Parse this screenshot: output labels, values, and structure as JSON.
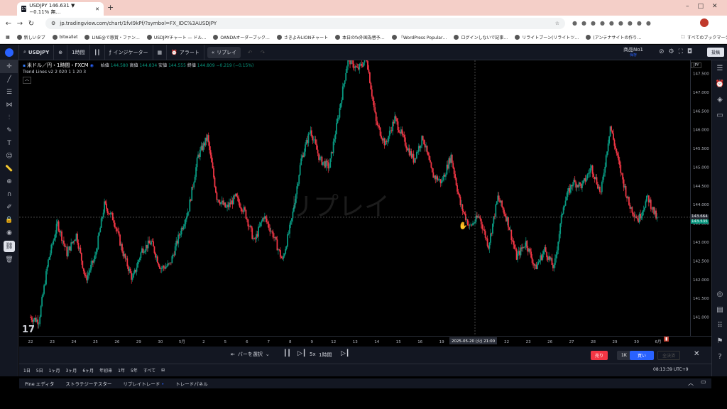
{
  "browser": {
    "tab_title": "USDJPY 146.631 ▼ −0.11% 無…",
    "url": "jp.tradingview.com/chart/1fvI9kPf/?symbol=FX_IDC%3AUSDJPY",
    "bookmarks": [
      "新しいタブ",
      "bitwallet",
      "LINE@で懸賞・ファン…",
      "USDJPYチャート — ドル…",
      "OANDAオーダーブック…",
      "さきよみLIONチャート",
      "本日のfx外国為替予…",
      "「WordPress Popular…",
      "ログインしないで記事…",
      "リライトブーン(リライトツ…",
      "(アンテナサイトの作り…"
    ],
    "bookmarks_all": "すべてのブックマーク"
  },
  "toolbar": {
    "symbol": "USDJPY",
    "interval": "1時間",
    "indicators": "インジケーター",
    "alert": "アラート",
    "replay": "リプレイ",
    "product": "商品No1",
    "product_sub": "保存",
    "publish": "投稿"
  },
  "legend": {
    "title": "米ドル／円・1時間・FXCM",
    "o_label": "始値",
    "o": "144.580",
    "h_label": "高値",
    "h": "144.834",
    "l_label": "安値",
    "l": "144.555",
    "c_label": "終値",
    "c": "144.809",
    "chg": "−0.219 (−0.15%)",
    "indicator": "Trend Lines v2  2 020 1 1 20 3"
  },
  "watermark": "リプレイ",
  "price_axis": {
    "currency": "JPY",
    "current": "143.664",
    "current2": "143.535"
  },
  "crosshair_time": "2025-05-20 (火)  21:00",
  "replay": {
    "select": "バーを選択",
    "speed": "5x",
    "interval": "1時間",
    "sell": "売り",
    "qty": "1K",
    "buy": "買い",
    "exit": "全決済"
  },
  "ranges": [
    "1日",
    "5日",
    "1ヶ月",
    "3ヶ月",
    "6ヶ月",
    "年初来",
    "1年",
    "5年",
    "すべて"
  ],
  "clock": "08:13:39 UTC+9",
  "panels": [
    "Pine エディタ",
    "ストラテジーテスター",
    "リプレイトレード",
    "トレードパネル"
  ],
  "chart_data": {
    "type": "candlestick",
    "symbol": "USDJPY",
    "interval": "1h",
    "x_ticks": [
      "22",
      "23",
      "24",
      "25",
      "26",
      "29",
      "30",
      "5月",
      "2",
      "5",
      "6",
      "7",
      "8",
      "9",
      "12",
      "13",
      "14",
      "15",
      "16",
      "19",
      "20",
      "21",
      "22",
      "23",
      "26",
      "27",
      "28",
      "29",
      "30",
      "6月"
    ],
    "y_ticks": [
      141.0,
      141.5,
      142.0,
      142.5,
      143.0,
      143.5,
      144.0,
      144.5,
      145.0,
      145.5,
      146.0,
      146.5,
      147.0,
      147.5
    ],
    "ylim": [
      140.5,
      147.85
    ],
    "path": [
      141.0,
      140.9,
      142.5,
      143.5,
      142.7,
      143.2,
      142.0,
      142.6,
      144.0,
      143.6,
      142.7,
      142.0,
      142.8,
      143.0,
      142.3,
      142.4,
      143.2,
      143.9,
      145.3,
      145.8,
      144.2,
      143.9,
      144.2,
      143.8,
      143.0,
      143.7,
      143.2,
      142.5,
      143.6,
      145.2,
      146.0,
      145.2,
      145.0,
      146.4,
      147.9,
      147.6,
      147.9,
      146.2,
      145.6,
      146.3,
      145.7,
      145.2,
      145.8,
      144.8,
      144.6,
      145.3,
      144.0,
      143.4,
      143.7,
      142.9,
      144.2,
      143.6,
      142.6,
      143.0,
      142.3,
      142.8,
      142.3,
      144.0,
      144.6,
      144.5,
      145.0,
      144.3,
      146.1,
      145.0,
      144.0,
      143.6,
      144.2,
      143.6
    ],
    "current": 143.664
  }
}
